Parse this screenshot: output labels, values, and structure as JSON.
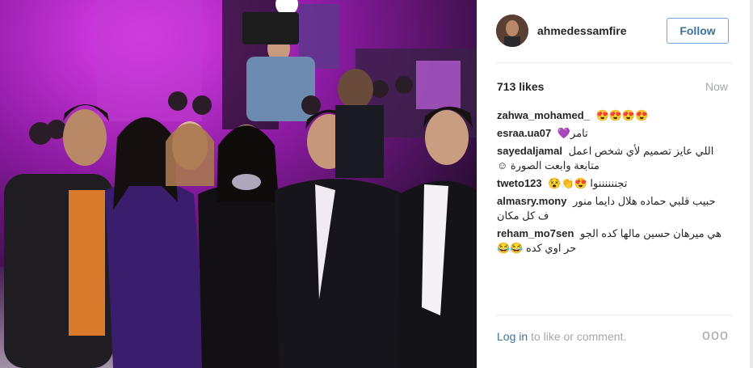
{
  "post": {
    "username": "ahmedessamfire",
    "follow_label": "Follow",
    "likes": "713 likes",
    "time": "Now",
    "comments": [
      {
        "user": "zahwa_mohamed_",
        "text": "😍😍😍😍"
      },
      {
        "user": "esraa.ua07",
        "text": "تامر💜"
      },
      {
        "user": "sayedaljamal",
        "text": "اللي عايز تصميم لأي شخص اعمل متابعة وابعت الصورة ☺"
      },
      {
        "user": "tweto123",
        "text": "تجننننننوا 😍👏😵"
      },
      {
        "user": "almasry.mony",
        "text": "حبيب قلبي حماده هلال دايما منور ف كل مكان"
      },
      {
        "user": "reham_mo7sen",
        "text": "هي ميرهان حسين مالها كده الجو حر اوي كده 😂😂"
      }
    ],
    "login_link": "Log in",
    "login_suffix": " to like or comment.",
    "more_label": "ooo"
  },
  "photo": {
    "description_icon": "event-photo",
    "colors": {
      "stage": "#a01bb0",
      "backdrop": "#2a1a3a",
      "floor": "#f2e6f5"
    }
  }
}
